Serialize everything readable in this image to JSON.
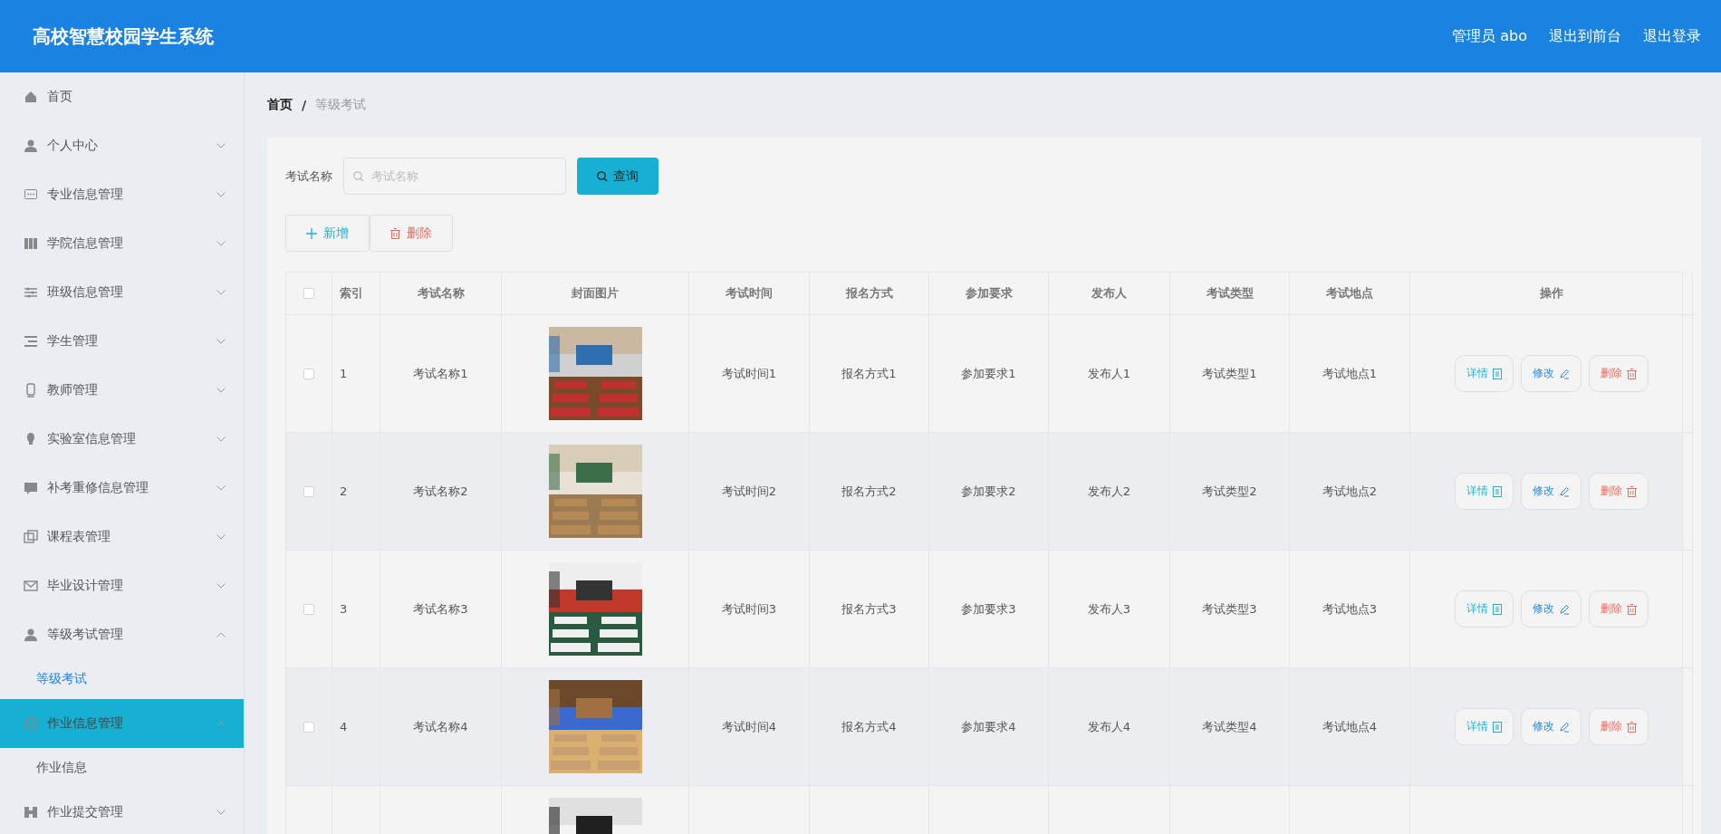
{
  "header": {
    "title": "高校智慧校园学生系统",
    "links": [
      "管理员 abo",
      "退出到前台",
      "退出登录"
    ]
  },
  "sidebar": {
    "items": [
      {
        "label": "首页",
        "kind": "link",
        "highlighted": false
      },
      {
        "label": "个人中心",
        "kind": "menu",
        "expanded": false,
        "highlighted": false
      },
      {
        "label": "专业信息管理",
        "kind": "menu",
        "expanded": false,
        "highlighted": false
      },
      {
        "label": "学院信息管理",
        "kind": "menu",
        "expanded": false,
        "highlighted": false
      },
      {
        "label": "班级信息管理",
        "kind": "menu",
        "expanded": false,
        "highlighted": false
      },
      {
        "label": "学生管理",
        "kind": "menu",
        "expanded": false,
        "highlighted": false
      },
      {
        "label": "教师管理",
        "kind": "menu",
        "expanded": false,
        "highlighted": false
      },
      {
        "label": "实验室信息管理",
        "kind": "menu",
        "expanded": false,
        "highlighted": false
      },
      {
        "label": "补考重修信息管理",
        "kind": "menu",
        "expanded": false,
        "highlighted": false
      },
      {
        "label": "课程表管理",
        "kind": "menu",
        "expanded": false,
        "highlighted": false
      },
      {
        "label": "毕业设计管理",
        "kind": "menu",
        "expanded": false,
        "highlighted": false
      },
      {
        "label": "等级考试管理",
        "kind": "menu",
        "expanded": true,
        "highlighted": false,
        "children": [
          {
            "label": "等级考试",
            "selected": true
          }
        ]
      },
      {
        "label": "作业信息管理",
        "kind": "menu",
        "expanded": true,
        "highlighted": true,
        "children": [
          {
            "label": "作业信息",
            "selected": false
          }
        ]
      },
      {
        "label": "作业提交管理",
        "kind": "menu",
        "expanded": false,
        "highlighted": false
      }
    ]
  },
  "breadcrumb": [
    "首页",
    "等级考试"
  ],
  "breadcrumb_separator": "/",
  "search": {
    "label": "考试名称",
    "placeholder": "考试名称",
    "button": "查询"
  },
  "actions": [
    {
      "label": "新增",
      "kind": "add"
    },
    {
      "label": "删除",
      "kind": "delete"
    }
  ],
  "table": {
    "select_all_checked": false,
    "columns": [
      "索引",
      "考试名称",
      "封面图片",
      "考试时间",
      "报名方式",
      "参加要求",
      "发布人",
      "考试类型",
      "考试地点",
      "操作"
    ],
    "rows": [
      {
        "checked": false,
        "cells": [
          "1",
          "考试名称1",
          {
            "kind": "picture"
          },
          "考试时间1",
          "报名方式1",
          "参加要求1",
          "发布人1",
          "考试类型1",
          "考试地点1"
        ],
        "buttons": [
          {
            "label": "详情",
            "kind": "detail"
          },
          {
            "label": "修改",
            "kind": "edit"
          },
          {
            "label": "删除",
            "kind": "delete"
          }
        ]
      },
      {
        "checked": false,
        "cells": [
          "2",
          "考试名称2",
          {
            "kind": "picture"
          },
          "考试时间2",
          "报名方式2",
          "参加要求2",
          "发布人2",
          "考试类型2",
          "考试地点2"
        ],
        "buttons": [
          {
            "label": "详情",
            "kind": "detail"
          },
          {
            "label": "修改",
            "kind": "edit"
          },
          {
            "label": "删除",
            "kind": "delete"
          }
        ]
      },
      {
        "checked": false,
        "cells": [
          "3",
          "考试名称3",
          {
            "kind": "picture"
          },
          "考试时间3",
          "报名方式3",
          "参加要求3",
          "发布人3",
          "考试类型3",
          "考试地点3"
        ],
        "buttons": [
          {
            "label": "详情",
            "kind": "detail"
          },
          {
            "label": "修改",
            "kind": "edit"
          },
          {
            "label": "删除",
            "kind": "delete"
          }
        ]
      },
      {
        "checked": false,
        "cells": [
          "4",
          "考试名称4",
          {
            "kind": "picture"
          },
          "考试时间4",
          "报名方式4",
          "参加要求4",
          "发布人4",
          "考试类型4",
          "考试地点4"
        ],
        "buttons": [
          {
            "label": "详情",
            "kind": "detail"
          },
          {
            "label": "修改",
            "kind": "edit"
          },
          {
            "label": "删除",
            "kind": "delete"
          }
        ]
      },
      {
        "cells": [
          null,
          null,
          {
            "kind": "picture"
          }
        ]
      }
    ]
  }
}
